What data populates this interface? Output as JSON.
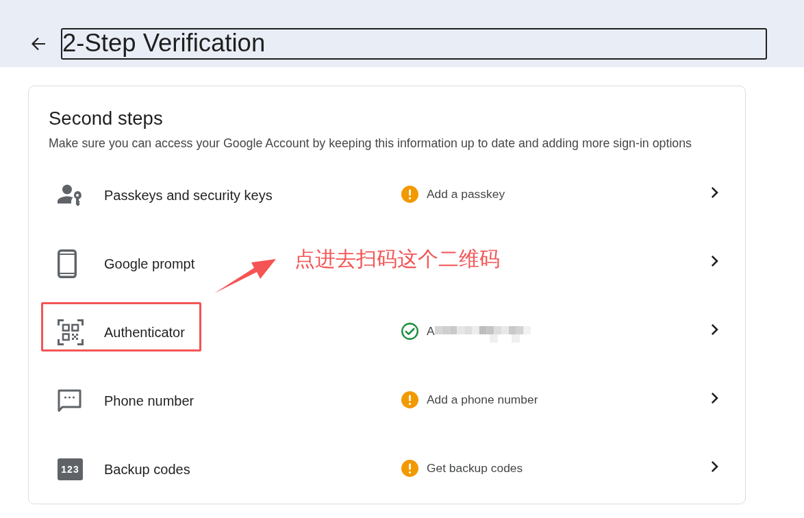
{
  "header": {
    "title": "2-Step Verification",
    "title_focused": true
  },
  "section": {
    "title": "Second steps",
    "description": "Make sure you can access your Google Account by keeping this information up to date and adding more sign-in options"
  },
  "rows": [
    {
      "kind": "passkey",
      "label": "Passkeys and security keys",
      "highlighted": false,
      "status": {
        "kind": "warning",
        "text": "Add a passkey",
        "redacted": false
      }
    },
    {
      "kind": "phone",
      "label": "Google prompt",
      "highlighted": false
    },
    {
      "kind": "qr",
      "label": "Authenticator",
      "highlighted": true,
      "status": {
        "kind": "done",
        "text": "A",
        "redacted": true
      }
    },
    {
      "kind": "message",
      "label": "Phone number",
      "highlighted": false,
      "status": {
        "kind": "warning",
        "text": "Add a phone number",
        "redacted": false
      }
    },
    {
      "kind": "codes",
      "label": "Backup codes",
      "icon_text": "123",
      "highlighted": false,
      "status": {
        "kind": "warning",
        "text": "Get backup codes",
        "redacted": false
      }
    }
  ],
  "annotation": {
    "text": "点进去扫码这个二维码"
  }
}
